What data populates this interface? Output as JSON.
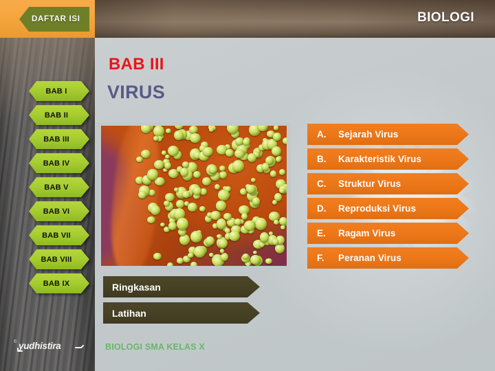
{
  "header": {
    "brand": "BIOLOGI",
    "toc_button": "DAFTAR ISI"
  },
  "sidebar": {
    "chapters": [
      {
        "label": "BAB I"
      },
      {
        "label": "BAB II"
      },
      {
        "label": "BAB III"
      },
      {
        "label": "BAB IV"
      },
      {
        "label": "BAB V"
      },
      {
        "label": "BAB VI"
      },
      {
        "label": "BAB VII"
      },
      {
        "label": "BAB VIII"
      },
      {
        "label": "BAB IX"
      }
    ],
    "logo_text": "yudhistira",
    "logo_mark": "©"
  },
  "slide": {
    "chapter_label": "BAB III",
    "chapter_title": "VIRUS",
    "image_alt": "virus-micrograph"
  },
  "sections": [
    {
      "letter": "A.",
      "label": "Sejarah Virus"
    },
    {
      "letter": "B.",
      "label": "Karakteristik Virus"
    },
    {
      "letter": "C.",
      "label": "Struktur Virus"
    },
    {
      "letter": "D.",
      "label": "Reproduksi Virus"
    },
    {
      "letter": "E.",
      "label": "Ragam Virus"
    },
    {
      "letter": "F.",
      "label": "Peranan Virus"
    }
  ],
  "extra_buttons": [
    {
      "label": "Ringkasan"
    },
    {
      "label": "Latihan"
    }
  ],
  "footer": {
    "course": "BIOLOGI SMA KELAS X"
  },
  "colors": {
    "chapter_label": "#e8161a",
    "chapter_title": "#585a86",
    "section_button": "#ec7718",
    "sidebar_button": "#a7cd31",
    "toc_button": "#6f7f28",
    "toc_bar": "#f6a53c",
    "dark_button": "#474124",
    "footer_text": "#6ab56a",
    "main_background": "#c6ccce"
  }
}
